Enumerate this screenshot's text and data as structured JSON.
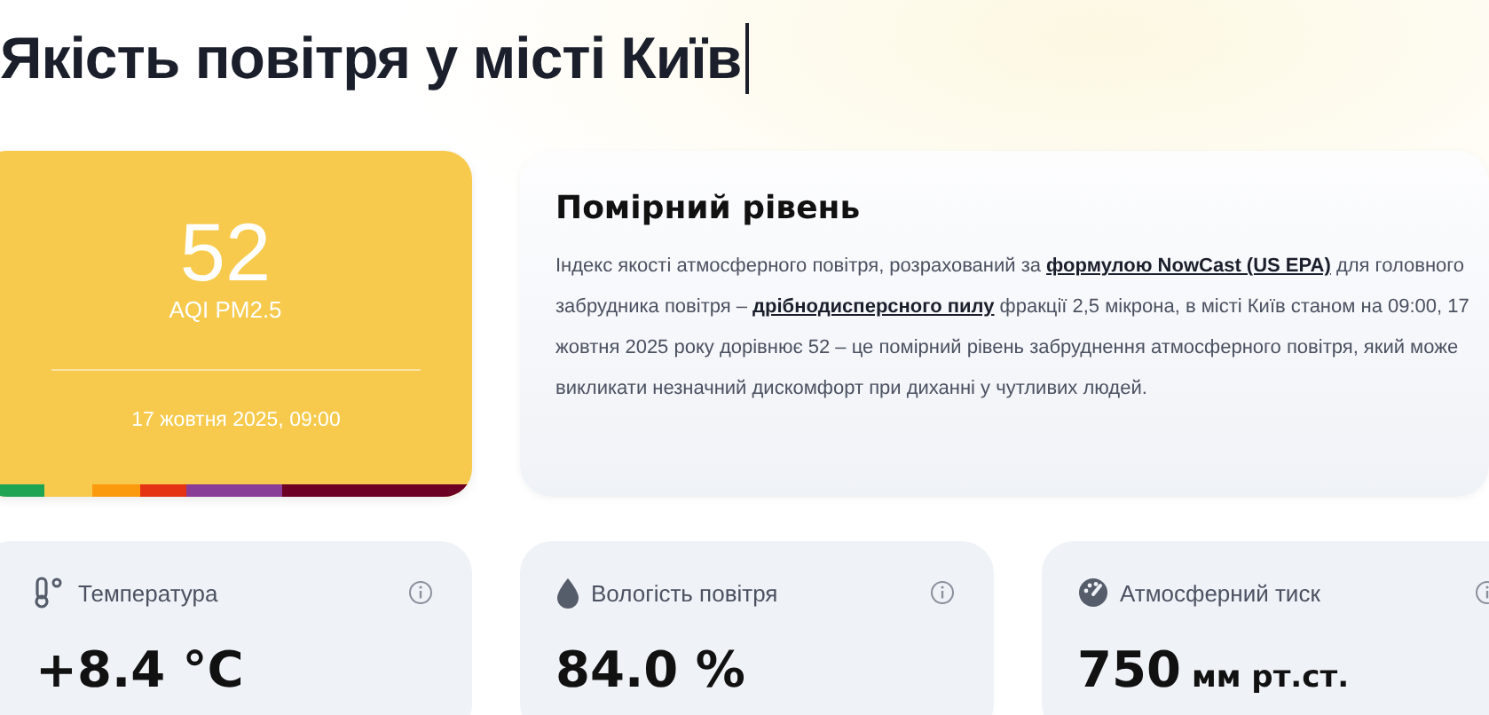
{
  "title": "Якість повітря у місті Київ",
  "aqi": {
    "value": "52",
    "label": "AQI PM2.5",
    "timestamp": "17 жовтня 2025, 09:00",
    "color": "#f7ca4d",
    "scale": [
      {
        "color": "#1fa454"
      },
      {
        "color": "#f7ca4d"
      },
      {
        "color": "#fb9a0c"
      },
      {
        "color": "#e53214"
      },
      {
        "color": "#8a3d96"
      },
      {
        "color": "#6b0024"
      }
    ]
  },
  "level_card": {
    "heading": "Помірний рівень",
    "description": [
      {
        "kind": "text",
        "text": "Індекс якості атмосферного повітря, розрахований за "
      },
      {
        "kind": "link",
        "text": "формулою NowCast (US EPA)"
      },
      {
        "kind": "text",
        "text": " для головного забрудника повітря – "
      },
      {
        "kind": "link",
        "text": "дрібнодисперсного пилу"
      },
      {
        "kind": "text",
        "text": " фракції 2,5 мікрона, в місті Київ станом на 09:00, 17 жовтня 2025 року дорівнює 52 – це помірний рівень забруднення атмосферного повітря, який може викликати незначний дискомфорт при диханні у чутливих людей."
      }
    ]
  },
  "metrics": [
    {
      "kind": "temperature",
      "label": "Температура",
      "value": "+8.4 °C"
    },
    {
      "kind": "humidity",
      "label": "Вологість повітря",
      "value": "84.0 %"
    },
    {
      "kind": "pressure",
      "label": "Атмосферний тиск",
      "value": "750",
      "unit": "мм рт.ст."
    }
  ]
}
